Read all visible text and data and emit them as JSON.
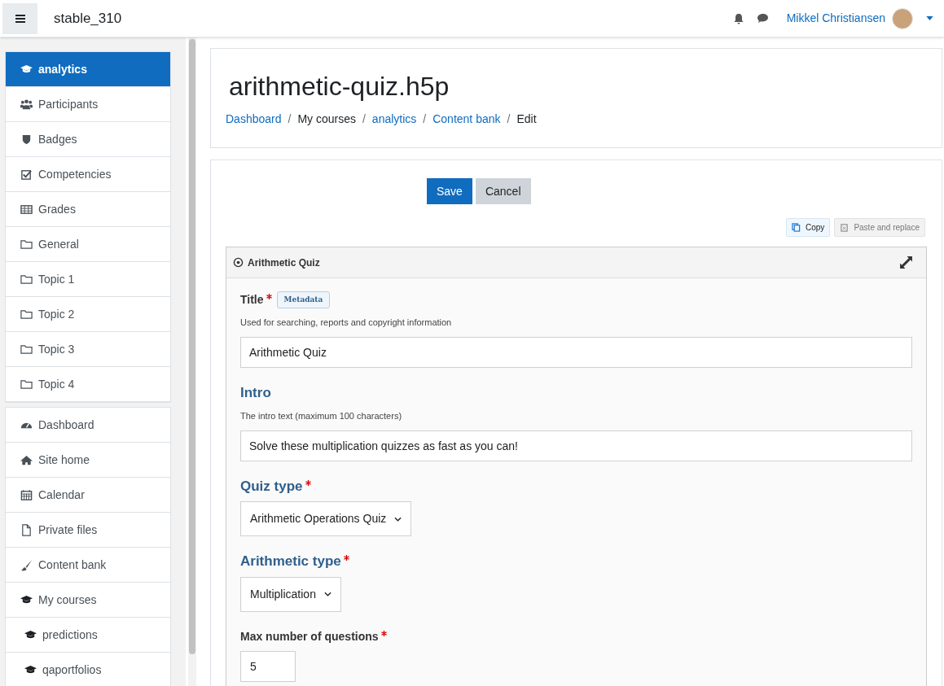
{
  "navbar": {
    "site_name": "stable_310",
    "user_name": "Mikkel Christiansen"
  },
  "sidebar": {
    "groups": [
      {
        "items": [
          {
            "label": "analytics",
            "selected": true
          },
          {
            "label": "Participants",
            "selected": false
          },
          {
            "label": "Badges",
            "selected": false
          },
          {
            "label": "Competencies",
            "selected": false
          },
          {
            "label": "Grades",
            "selected": false
          },
          {
            "label": "General",
            "selected": false
          },
          {
            "label": "Topic 1",
            "selected": false
          },
          {
            "label": "Topic 2",
            "selected": false
          },
          {
            "label": "Topic 3",
            "selected": false
          },
          {
            "label": "Topic 4",
            "selected": false
          }
        ]
      },
      {
        "items": [
          {
            "label": "Dashboard",
            "selected": false
          },
          {
            "label": "Site home",
            "selected": false
          },
          {
            "label": "Calendar",
            "selected": false
          },
          {
            "label": "Private files",
            "selected": false
          },
          {
            "label": "Content bank",
            "selected": false
          },
          {
            "label": "My courses",
            "selected": false,
            "children": [
              {
                "label": "predictions",
                "selected": false
              },
              {
                "label": "qaportfolios",
                "selected": false
              }
            ]
          }
        ]
      }
    ]
  },
  "page": {
    "title": "arithmetic-quiz.h5p",
    "breadcrumb": [
      {
        "kind": "item",
        "label": "Dashboard",
        "link": true
      },
      {
        "kind": "separator",
        "label": "/"
      },
      {
        "kind": "item",
        "label": "My courses",
        "link": false
      },
      {
        "kind": "separator",
        "label": "/"
      },
      {
        "kind": "item",
        "label": "analytics",
        "link": true
      },
      {
        "kind": "separator",
        "label": "/"
      },
      {
        "kind": "item",
        "label": "Content bank",
        "link": true
      },
      {
        "kind": "separator",
        "label": "/"
      },
      {
        "kind": "item",
        "label": "Edit",
        "link": false
      }
    ]
  },
  "editor": {
    "buttons": [
      {
        "label": "Save",
        "primary": true
      },
      {
        "label": "Cancel",
        "primary": false
      }
    ],
    "clipboard": [
      {
        "label": "Copy",
        "enabled": true
      },
      {
        "label": "Paste and replace",
        "enabled": false
      }
    ],
    "content_title": "Arithmetic Quiz",
    "fields": [
      {
        "kind": "text",
        "label": "Title",
        "emphasized": false,
        "required": true,
        "badge": "Metadata",
        "description": "Used for searching, reports and copyright information",
        "value": "Arithmetic Quiz"
      },
      {
        "kind": "text",
        "label": "Intro",
        "emphasized": true,
        "required": false,
        "description": "The intro text (maximum 100 characters)",
        "value": "Solve these multiplication quizzes as fast as you can!"
      },
      {
        "kind": "select",
        "label": "Quiz type",
        "emphasized": true,
        "required": true,
        "value": "Arithmetic Operations Quiz"
      },
      {
        "kind": "select",
        "label": "Arithmetic type",
        "emphasized": true,
        "required": true,
        "value": "Multiplication"
      },
      {
        "kind": "number",
        "label": "Max number of questions",
        "emphasized": false,
        "required": true,
        "value": "5"
      }
    ]
  }
}
